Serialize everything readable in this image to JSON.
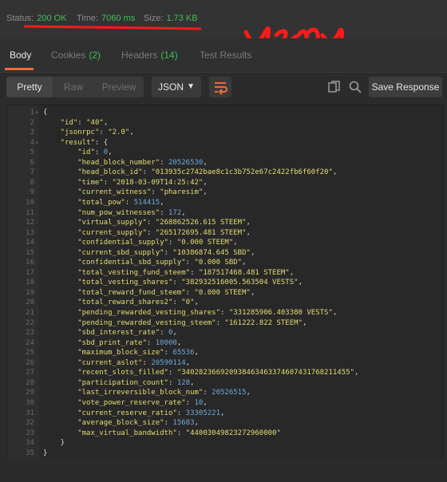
{
  "status_bar": {
    "status_label": "Status:",
    "status_value": "200 OK",
    "time_label": "Time:",
    "time_value": "7060 ms",
    "size_label": "Size:",
    "size_value": "1.73 KB",
    "annotation_text": "yeny"
  },
  "tabs": [
    {
      "label": "Body",
      "count": ""
    },
    {
      "label": "Cookies",
      "count": "(2)"
    },
    {
      "label": "Headers",
      "count": "(14)"
    },
    {
      "label": "Test Results",
      "count": ""
    }
  ],
  "toolbar": {
    "view_modes": [
      "Pretty",
      "Raw",
      "Preview"
    ],
    "format": "JSON",
    "save_label": "Save Response"
  },
  "colors": {
    "accent": "#f26b3a",
    "status_green": "#3fbf57",
    "annotation_red": "#ff1a1a"
  },
  "icons": [
    "wrap-lines-icon",
    "copy-icon",
    "search-icon",
    "chevron-down-icon"
  ],
  "code_lines": [
    {
      "n": "1",
      "fold": "▾",
      "indent": 0,
      "key": "",
      "value": "",
      "vtype": "",
      "tail": "{"
    },
    {
      "n": "2",
      "fold": "",
      "indent": 4,
      "key": "\"id\"",
      "value": "\"40\"",
      "vtype": "s",
      "tail": ","
    },
    {
      "n": "3",
      "fold": "",
      "indent": 4,
      "key": "\"jsonrpc\"",
      "value": "\"2.0\"",
      "vtype": "s",
      "tail": ","
    },
    {
      "n": "4",
      "fold": "▾",
      "indent": 4,
      "key": "\"result\"",
      "value": "",
      "vtype": "",
      "tail": "{"
    },
    {
      "n": "5",
      "fold": "",
      "indent": 8,
      "key": "\"id\"",
      "value": "0",
      "vtype": "n",
      "tail": ","
    },
    {
      "n": "6",
      "fold": "",
      "indent": 8,
      "key": "\"head_block_number\"",
      "value": "20526530",
      "vtype": "n",
      "tail": ","
    },
    {
      "n": "7",
      "fold": "",
      "indent": 8,
      "key": "\"head_block_id\"",
      "value": "\"013935c2742bae8c1c3b752e67c2422fb6f60f20\"",
      "vtype": "s",
      "tail": ","
    },
    {
      "n": "8",
      "fold": "",
      "indent": 8,
      "key": "\"time\"",
      "value": "\"2018-03-09T14:25:42\"",
      "vtype": "s",
      "tail": ","
    },
    {
      "n": "9",
      "fold": "",
      "indent": 8,
      "key": "\"current_witness\"",
      "value": "\"pharesim\"",
      "vtype": "s",
      "tail": ","
    },
    {
      "n": "10",
      "fold": "",
      "indent": 8,
      "key": "\"total_pow\"",
      "value": "514415",
      "vtype": "n",
      "tail": ","
    },
    {
      "n": "11",
      "fold": "",
      "indent": 8,
      "key": "\"num_pow_witnesses\"",
      "value": "172",
      "vtype": "n",
      "tail": ","
    },
    {
      "n": "12",
      "fold": "",
      "indent": 8,
      "key": "\"virtual_supply\"",
      "value": "\"268862526.615 STEEM\"",
      "vtype": "s",
      "tail": ","
    },
    {
      "n": "13",
      "fold": "",
      "indent": 8,
      "key": "\"current_supply\"",
      "value": "\"265172695.481 STEEM\"",
      "vtype": "s",
      "tail": ","
    },
    {
      "n": "14",
      "fold": "",
      "indent": 8,
      "key": "\"confidential_supply\"",
      "value": "\"0.000 STEEM\"",
      "vtype": "s",
      "tail": ","
    },
    {
      "n": "15",
      "fold": "",
      "indent": 8,
      "key": "\"current_sbd_supply\"",
      "value": "\"10386874.645 SBD\"",
      "vtype": "s",
      "tail": ","
    },
    {
      "n": "16",
      "fold": "",
      "indent": 8,
      "key": "\"confidential_sbd_supply\"",
      "value": "\"0.000 SBD\"",
      "vtype": "s",
      "tail": ","
    },
    {
      "n": "17",
      "fold": "",
      "indent": 8,
      "key": "\"total_vesting_fund_steem\"",
      "value": "\"187517468.481 STEEM\"",
      "vtype": "s",
      "tail": ","
    },
    {
      "n": "18",
      "fold": "",
      "indent": 8,
      "key": "\"total_vesting_shares\"",
      "value": "\"382932516005.563504 VESTS\"",
      "vtype": "s",
      "tail": ","
    },
    {
      "n": "19",
      "fold": "",
      "indent": 8,
      "key": "\"total_reward_fund_steem\"",
      "value": "\"0.000 STEEM\"",
      "vtype": "s",
      "tail": ","
    },
    {
      "n": "20",
      "fold": "",
      "indent": 8,
      "key": "\"total_reward_shares2\"",
      "value": "\"0\"",
      "vtype": "s",
      "tail": ","
    },
    {
      "n": "21",
      "fold": "",
      "indent": 8,
      "key": "\"pending_rewarded_vesting_shares\"",
      "value": "\"331285906.403380 VESTS\"",
      "vtype": "s",
      "tail": ","
    },
    {
      "n": "22",
      "fold": "",
      "indent": 8,
      "key": "\"pending_rewarded_vesting_steem\"",
      "value": "\"161222.822 STEEM\"",
      "vtype": "s",
      "tail": ","
    },
    {
      "n": "23",
      "fold": "",
      "indent": 8,
      "key": "\"sbd_interest_rate\"",
      "value": "0",
      "vtype": "n",
      "tail": ","
    },
    {
      "n": "24",
      "fold": "",
      "indent": 8,
      "key": "\"sbd_print_rate\"",
      "value": "10000",
      "vtype": "n",
      "tail": ","
    },
    {
      "n": "25",
      "fold": "",
      "indent": 8,
      "key": "\"maximum_block_size\"",
      "value": "65536",
      "vtype": "n",
      "tail": ","
    },
    {
      "n": "26",
      "fold": "",
      "indent": 8,
      "key": "\"current_aslot\"",
      "value": "20590114",
      "vtype": "n",
      "tail": ","
    },
    {
      "n": "27",
      "fold": "",
      "indent": 8,
      "key": "\"recent_slots_filled\"",
      "value": "\"340282366920938463463374607431768211455\"",
      "vtype": "s",
      "tail": ","
    },
    {
      "n": "28",
      "fold": "",
      "indent": 8,
      "key": "\"participation_count\"",
      "value": "128",
      "vtype": "n",
      "tail": ","
    },
    {
      "n": "29",
      "fold": "",
      "indent": 8,
      "key": "\"last_irreversible_block_num\"",
      "value": "20526515",
      "vtype": "n",
      "tail": ","
    },
    {
      "n": "30",
      "fold": "",
      "indent": 8,
      "key": "\"vote_power_reserve_rate\"",
      "value": "10",
      "vtype": "n",
      "tail": ","
    },
    {
      "n": "31",
      "fold": "",
      "indent": 8,
      "key": "\"current_reserve_ratio\"",
      "value": "33305221",
      "vtype": "n",
      "tail": ","
    },
    {
      "n": "32",
      "fold": "",
      "indent": 8,
      "key": "\"average_block_size\"",
      "value": "15683",
      "vtype": "n",
      "tail": ","
    },
    {
      "n": "33",
      "fold": "",
      "indent": 8,
      "key": "\"max_virtual_bandwidth\"",
      "value": "\"44003049823272960000\"",
      "vtype": "s",
      "tail": ""
    },
    {
      "n": "34",
      "fold": "",
      "indent": 4,
      "key": "",
      "value": "",
      "vtype": "",
      "tail": "}"
    },
    {
      "n": "35",
      "fold": "",
      "indent": 0,
      "key": "",
      "value": "",
      "vtype": "",
      "tail": "}"
    }
  ]
}
